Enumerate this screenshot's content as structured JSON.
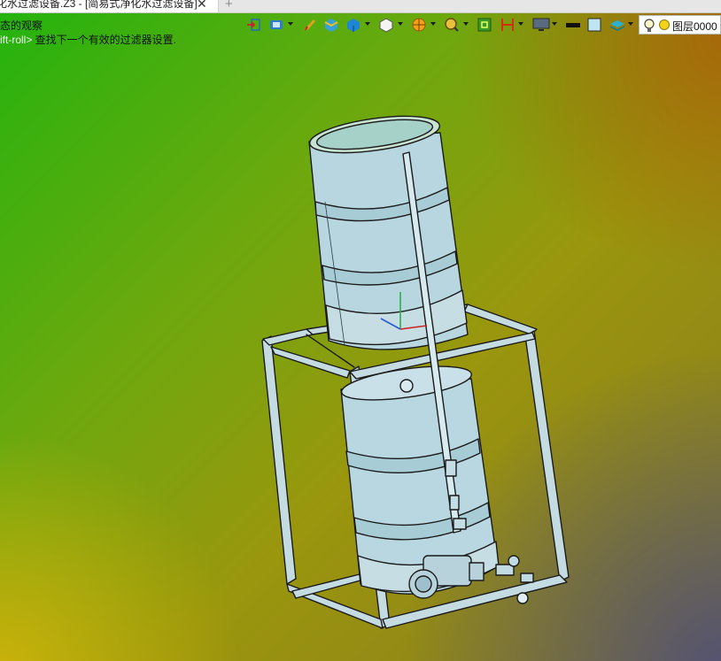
{
  "tab": {
    "title": "化水过滤设备.Z3 - [简易式净化水过滤设备]",
    "close_icon": "close-icon",
    "add_icon": "plus-icon"
  },
  "prompts": {
    "line1": "态的观察",
    "line2_key": "ift-roll>",
    "line2_text": " 查找下一个有效的过滤器设置."
  },
  "toolbar": {
    "icons": [
      "exit-view-icon",
      "view-orient-icon",
      "pen-icon",
      "shaded-cube-icon",
      "cube-display-icon",
      "white-cube-icon",
      "render-ball-icon",
      "zoom-view-icon",
      "screen-capture-icon",
      "dimension-icon",
      "monitor-icon",
      "line-color-icon",
      "face-color-icon",
      "layer-stack-icon"
    ]
  },
  "layer": {
    "label": "图层0000",
    "bulb_icon": "lightbulb-icon",
    "color": "#f3d21a"
  },
  "colors": {
    "model_fill": "#b9d6df",
    "model_line": "#1a1a1a"
  }
}
